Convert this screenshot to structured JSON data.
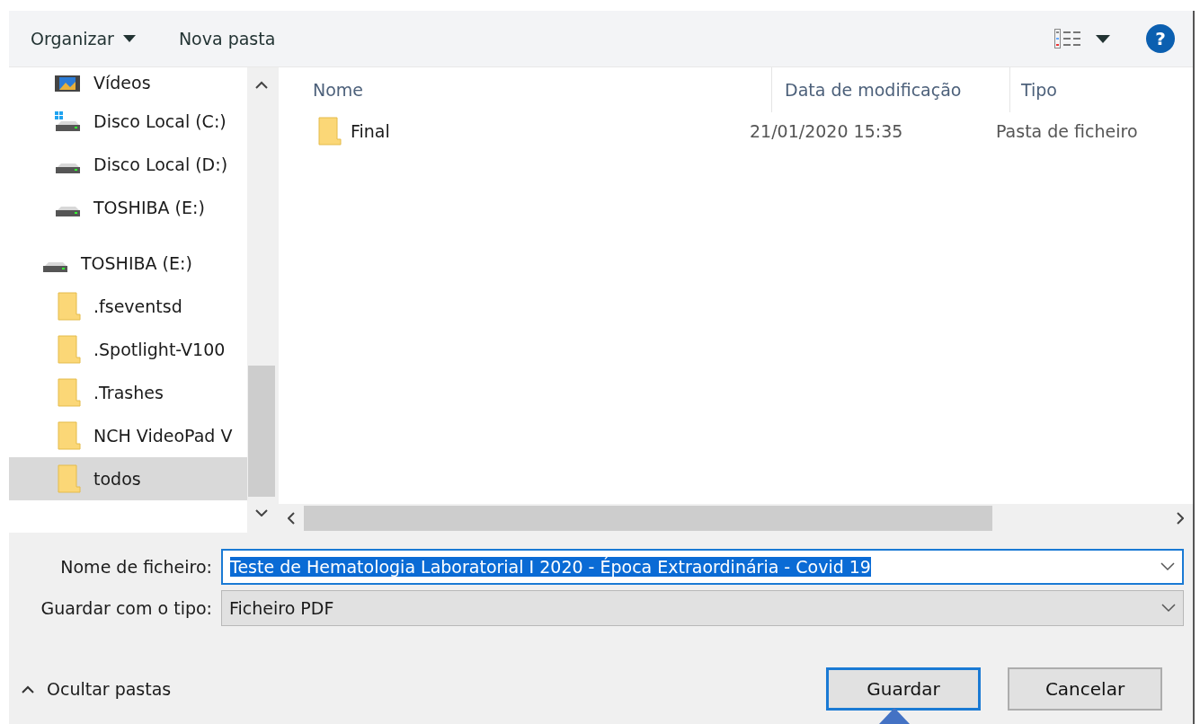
{
  "toolbar": {
    "organize": "Organizar",
    "new_folder": "Nova pasta",
    "help": "?"
  },
  "nav": {
    "items": [
      {
        "label": "Vídeos",
        "kind": "video",
        "selected": false
      },
      {
        "label": "Disco Local (C:)",
        "kind": "system-drive",
        "selected": false
      },
      {
        "label": "Disco Local (D:)",
        "kind": "drive",
        "selected": false
      },
      {
        "label": "TOSHIBA (E:)",
        "kind": "drive",
        "selected": false
      },
      {
        "label": "TOSHIBA (E:)",
        "kind": "drive",
        "selected": false,
        "children": [
          {
            "label": ".fseventsd",
            "kind": "folder",
            "selected": false
          },
          {
            "label": ".Spotlight-V100",
            "kind": "folder",
            "selected": false
          },
          {
            "label": ".Trashes",
            "kind": "folder",
            "selected": false
          },
          {
            "label": "NCH VideoPad V",
            "kind": "folder",
            "selected": false
          },
          {
            "label": "todos",
            "kind": "folder",
            "selected": true
          }
        ]
      }
    ]
  },
  "table": {
    "columns": [
      "Nome",
      "Data de modificação",
      "Tipo"
    ],
    "rows": [
      {
        "name": "Final",
        "date": "21/01/2020 15:35",
        "type": "Pasta de ficheiro"
      }
    ]
  },
  "form": {
    "filename_label": "Nome de ficheiro:",
    "filename": "Teste de Hematologia Laboratorial I 2020 - Época Extraordinária - Covid 19",
    "type_label": "Guardar com o tipo:",
    "type": "Ficheiro PDF"
  },
  "hide_folders": "Ocultar pastas",
  "buttons": [
    {
      "label": "Guardar",
      "default": true
    },
    {
      "label": "Cancelar",
      "default": false
    }
  ]
}
